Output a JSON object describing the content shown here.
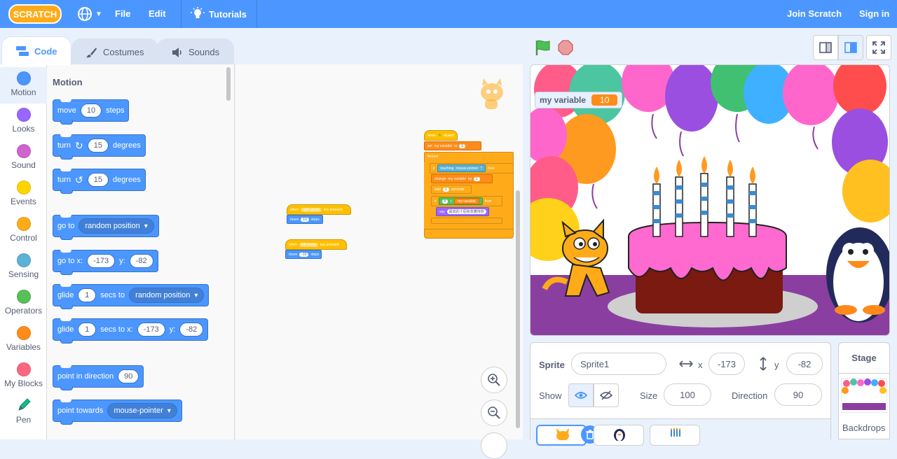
{
  "menu": {
    "logo_text": "SCRATCH",
    "file": "File",
    "edit": "Edit",
    "tutorials": "Tutorials",
    "join": "Join Scratch",
    "signin": "Sign in"
  },
  "tabs": {
    "code": "Code",
    "costumes": "Costumes",
    "sounds": "Sounds"
  },
  "categories": [
    {
      "label": "Motion",
      "color": "#4c97ff"
    },
    {
      "label": "Looks",
      "color": "#9966ff"
    },
    {
      "label": "Sound",
      "color": "#cf63cf"
    },
    {
      "label": "Events",
      "color": "#ffd500"
    },
    {
      "label": "Control",
      "color": "#ffab19"
    },
    {
      "label": "Sensing",
      "color": "#5cb1d6"
    },
    {
      "label": "Operators",
      "color": "#59c059"
    },
    {
      "label": "Variables",
      "color": "#ff8c1a"
    },
    {
      "label": "My Blocks",
      "color": "#ff6680"
    },
    {
      "label": "Pen",
      "color": "#0fbd8c"
    }
  ],
  "palette": {
    "title": "Motion",
    "move": {
      "a": "move",
      "n": "10",
      "b": "steps"
    },
    "turn_cw": {
      "a": "turn",
      "n": "15",
      "b": "degrees"
    },
    "turn_ccw": {
      "a": "turn",
      "n": "15",
      "b": "degrees"
    },
    "goto": {
      "a": "go to",
      "d": "random position"
    },
    "goto_xy": {
      "a": "go to x:",
      "x": "-173",
      "y_label": "y:",
      "y": "-82"
    },
    "glide": {
      "a": "glide",
      "n": "1",
      "b": "secs to",
      "d": "random position"
    },
    "glide_xy": {
      "a": "glide",
      "n": "1",
      "b": "secs to x:",
      "x": "-173",
      "y_label": "y:",
      "y": "-82"
    },
    "point_dir": {
      "a": "point in direction",
      "n": "90"
    },
    "point_towards": {
      "a": "point towards",
      "d": "mouse-pointer"
    }
  },
  "script1": {
    "hat": "when",
    "key": "right arrow",
    "hat2": "key pressed",
    "move": "move",
    "n": "10",
    "steps": "steps"
  },
  "script2": {
    "hat": "when",
    "key": "left arrow",
    "hat2": "key pressed",
    "move": "move",
    "n": "-10",
    "steps": "steps"
  },
  "script3": {
    "when": "when",
    "clicked": "clicked",
    "set": "set",
    "var": "my variable",
    "to": "to",
    "zero": "0",
    "forever": "forever",
    "if": "if",
    "touching": "touching",
    "pointer": "mouse-pointer",
    "q": "?",
    "then": "then",
    "change": "change",
    "by": "by",
    "one": "1",
    "wait": "wait",
    "secs": "seconds",
    "if2": "if",
    "eight": "8",
    "lt": "<",
    "then2": "then",
    "say": "say",
    "msg": "最高的十個有收藏待辦"
  },
  "stage": {
    "monitor_label": "my variable",
    "monitor_value": "10"
  },
  "sprite_info": {
    "sprite_label": "Sprite",
    "sprite_name": "Sprite1",
    "x_label": "x",
    "x": "-173",
    "y_label": "y",
    "y": "-82",
    "show_label": "Show",
    "size_label": "Size",
    "size": "100",
    "direction_label": "Direction",
    "direction": "90"
  },
  "stage_panel": {
    "title": "Stage",
    "backdrops": "Backdrops"
  }
}
